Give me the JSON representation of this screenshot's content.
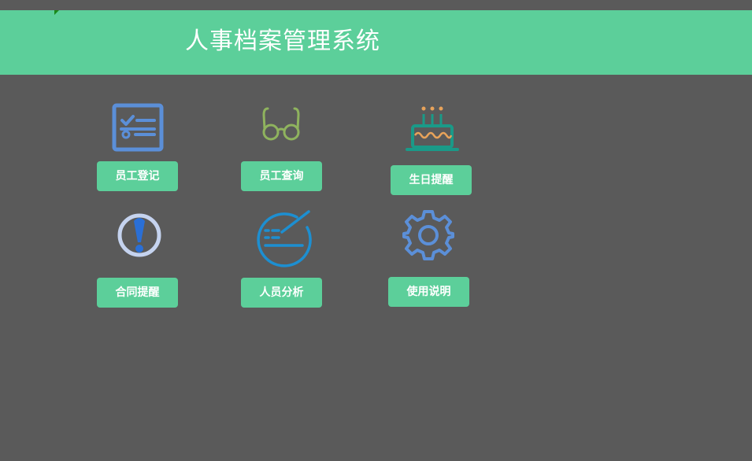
{
  "header": {
    "title": "人事档案管理系统"
  },
  "menu": {
    "items": [
      {
        "label": "员工登记",
        "icon": "checklist-icon"
      },
      {
        "label": "员工查询",
        "icon": "glasses-icon"
      },
      {
        "label": "生日提醒",
        "icon": "birthday-cake-icon"
      },
      {
        "label": "合同提醒",
        "icon": "exclamation-icon"
      },
      {
        "label": "人员分析",
        "icon": "analysis-icon"
      },
      {
        "label": "使用说明",
        "icon": "gear-icon"
      }
    ]
  },
  "colors": {
    "header_bg": "#5ccf9a",
    "background": "#5a5a5a",
    "button_bg": "#5ccf9a"
  }
}
